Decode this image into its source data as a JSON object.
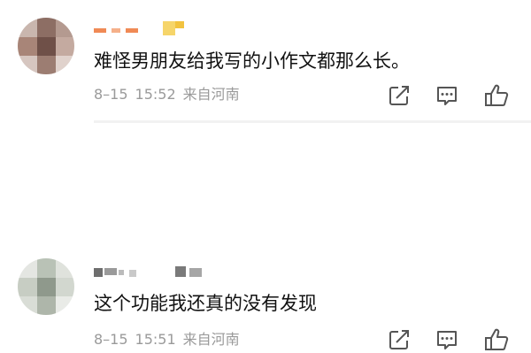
{
  "comments": [
    {
      "text": "难怪男朋友给我写的小作文都那么长。",
      "date": "8–15",
      "time": "15:52",
      "location": "来自河南",
      "actions": {
        "share_icon": "share-icon",
        "reply_icon": "comment-icon",
        "like_icon": "thumbs-up-icon"
      }
    },
    {
      "text": "这个功能我还真的没有发现",
      "date": "8–15",
      "time": "15:51",
      "location": "来自河南",
      "actions": {
        "share_icon": "share-icon",
        "reply_icon": "comment-icon",
        "like_icon": "thumbs-up-icon"
      }
    }
  ],
  "colors": {
    "text": "#111111",
    "meta": "#9a9a9a",
    "icon": "#555555",
    "username_accent_1": "#f08a55",
    "username_accent_2": "#f2c33f"
  }
}
